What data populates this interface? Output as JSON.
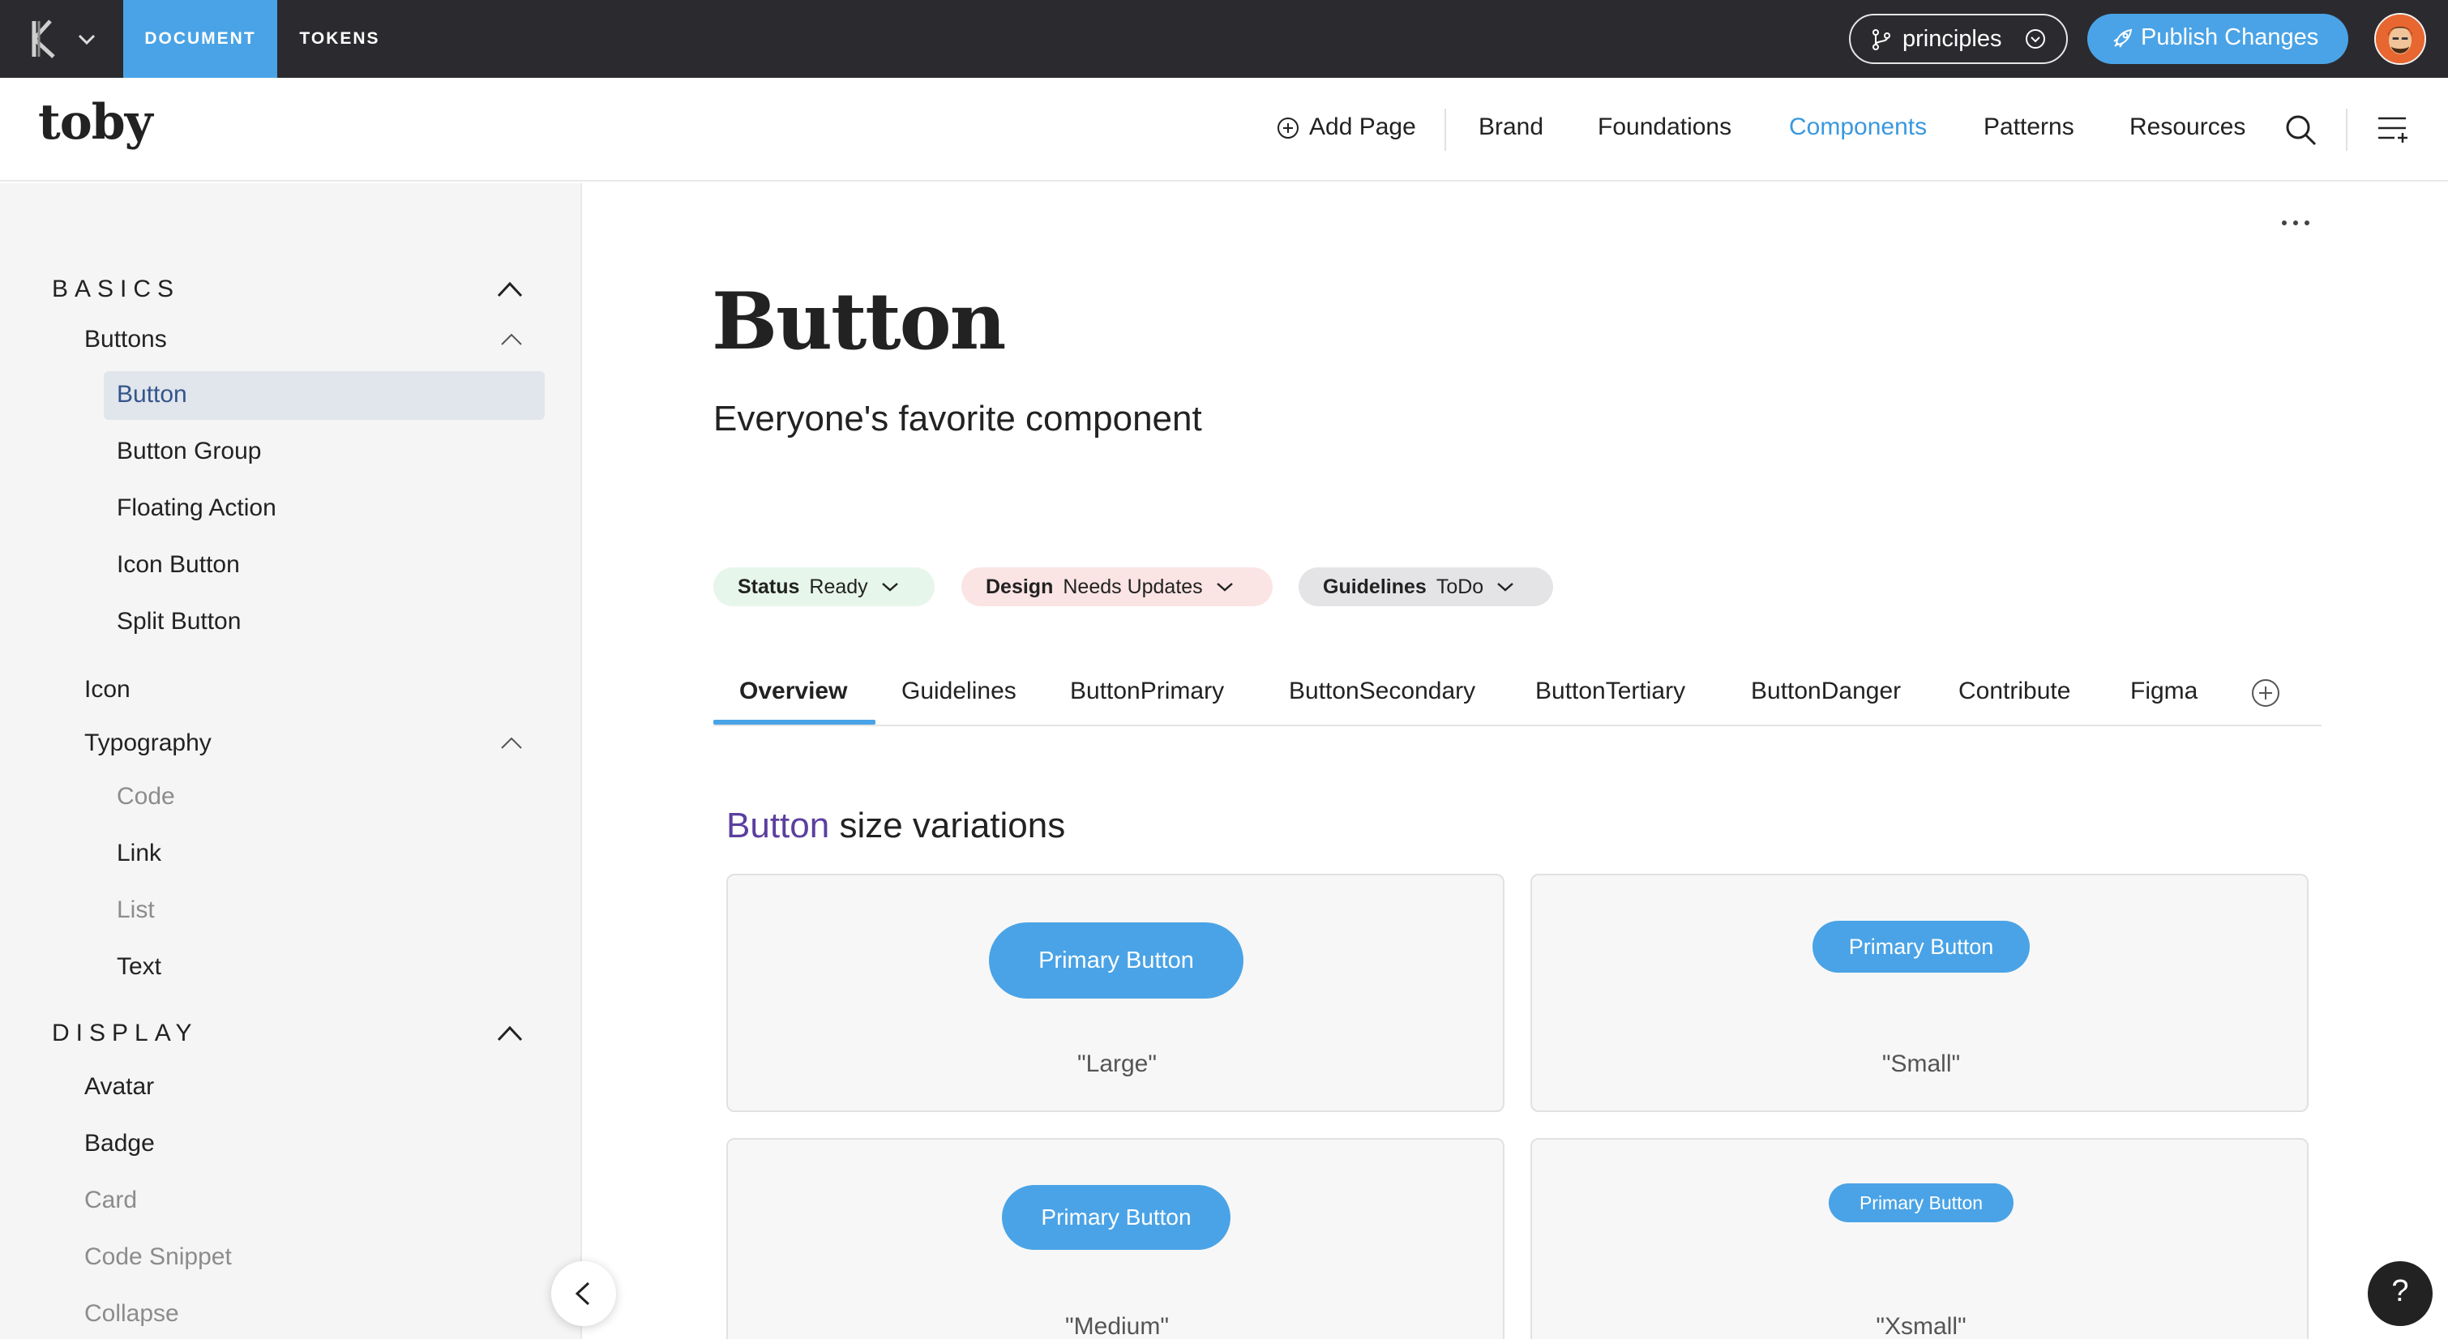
{
  "topbar": {
    "modes": [
      "DOCUMENT",
      "TOKENS"
    ],
    "branch_label": "principles",
    "publish_label": "Publish Changes"
  },
  "subnav": {
    "brand": "toby",
    "add_page": "Add Page",
    "items": [
      "Brand",
      "Foundations",
      "Components",
      "Patterns",
      "Resources"
    ],
    "active": "Components"
  },
  "sidebar": {
    "basics": {
      "title": "BASICS",
      "buttons_group": "Buttons",
      "buttons_items": [
        "Button",
        "Button Group",
        "Floating Action",
        "Icon Button",
        "Split Button"
      ],
      "icon": "Icon",
      "typography_group": "Typography",
      "typography_items": [
        "Code",
        "Link",
        "List",
        "Text"
      ]
    },
    "display": {
      "title": "DISPLAY",
      "items": [
        "Avatar",
        "Badge",
        "Card",
        "Code Snippet",
        "Collapse"
      ]
    }
  },
  "main": {
    "title": "Button",
    "subtitle": "Everyone's favorite component",
    "pills": {
      "status": {
        "label": "Status",
        "value": "Ready"
      },
      "design": {
        "label": "Design",
        "value": "Needs Updates"
      },
      "guidelines": {
        "label": "Guidelines",
        "value": "ToDo"
      }
    },
    "tabs": [
      "Overview",
      "Guidelines",
      "ButtonPrimary",
      "ButtonSecondary",
      "ButtonTertiary",
      "ButtonDanger",
      "Contribute",
      "Figma"
    ],
    "section_heading_accent": "Button",
    "section_heading_rest": " size variations",
    "cards": [
      {
        "button": "Primary Button",
        "caption": "\"Large\""
      },
      {
        "button": "Primary Button",
        "caption": "\"Small\""
      },
      {
        "button": "Primary Button",
        "caption": "\"Medium\""
      },
      {
        "button": "Primary Button",
        "caption": "\"Xsmall\""
      }
    ],
    "help": "?"
  },
  "colors": {
    "topbar_bg": "#2b2b2f",
    "accent_blue": "#4aa3e6",
    "heading_accent": "#5b3f9f",
    "status_bg": "#e7f6ea",
    "design_bg": "#fbe4e4",
    "guidelines_bg": "#e4e4e7"
  }
}
